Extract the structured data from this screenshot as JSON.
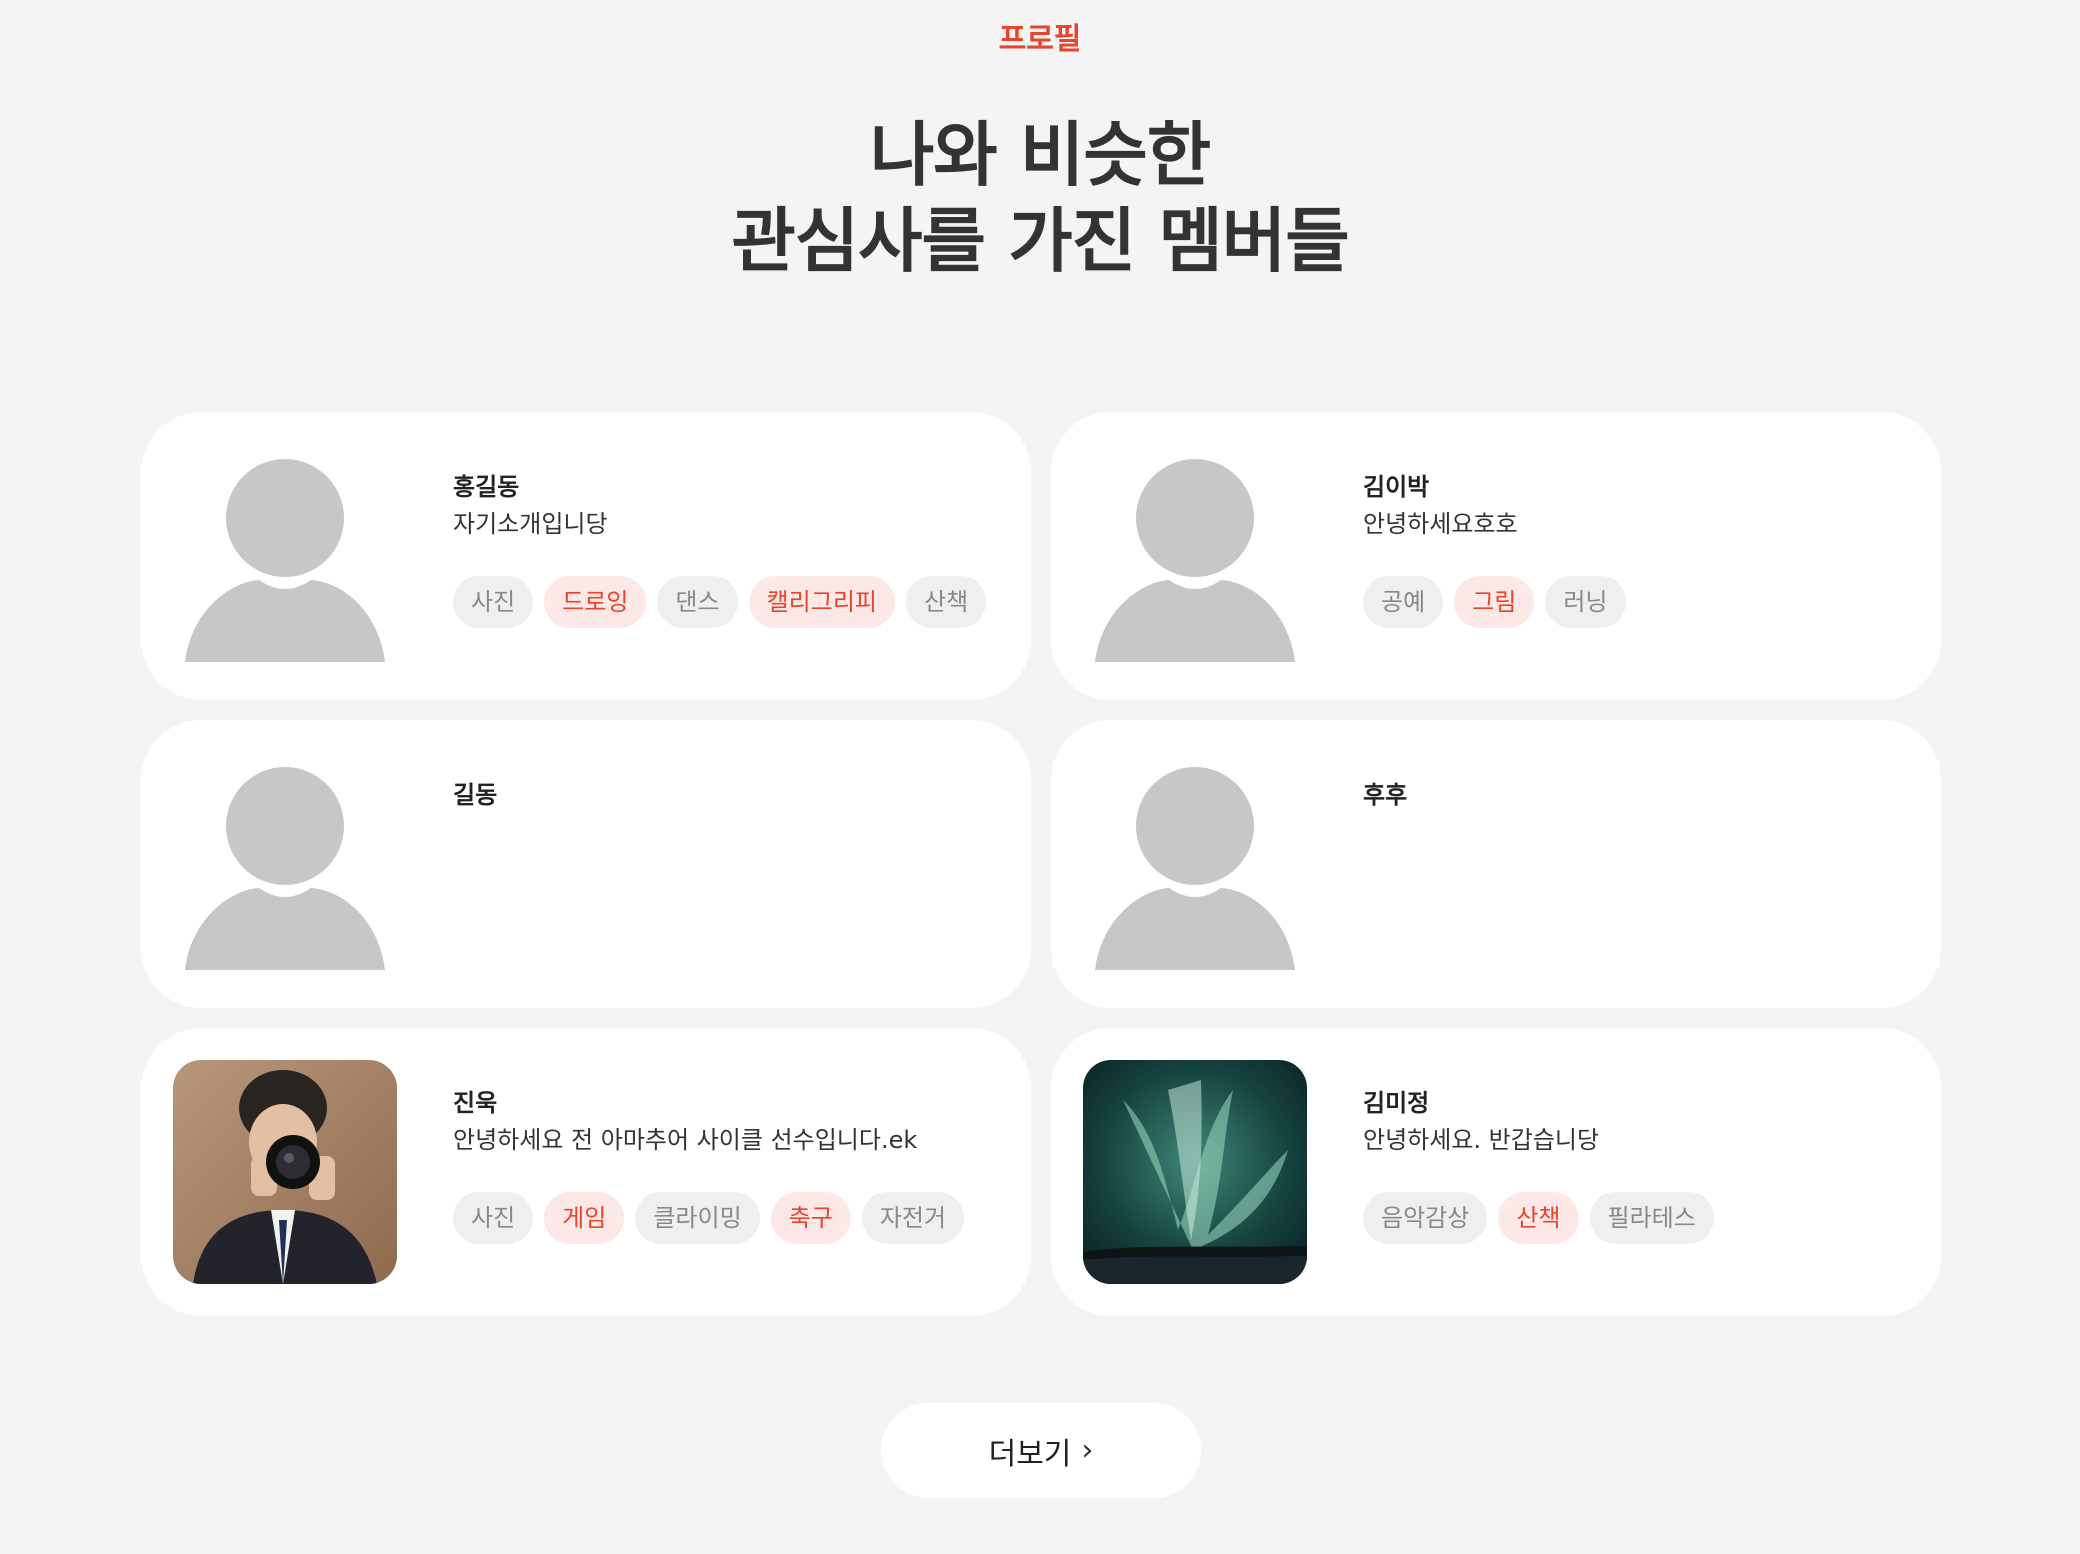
{
  "eyebrow": "프로필",
  "heading": {
    "line1": "나와 비슷한",
    "line2": "관심사를 가진 멤버들"
  },
  "members": [
    {
      "name": "홍길동",
      "intro": "자기소개입니당",
      "photo": "default-avatar-icon",
      "tags": [
        {
          "label": "사진",
          "hl": false
        },
        {
          "label": "드로잉",
          "hl": true
        },
        {
          "label": "댄스",
          "hl": false
        },
        {
          "label": "캘리그리피",
          "hl": true
        },
        {
          "label": "산책",
          "hl": false
        }
      ]
    },
    {
      "name": "김이박",
      "intro": "안녕하세요호호",
      "photo": "default-avatar-icon",
      "tags": [
        {
          "label": "공예",
          "hl": false
        },
        {
          "label": "그림",
          "hl": true
        },
        {
          "label": "러닝",
          "hl": false
        }
      ]
    },
    {
      "name": "길동",
      "intro": "",
      "photo": "default-avatar-icon",
      "tags": []
    },
    {
      "name": "후후",
      "intro": "",
      "photo": "default-avatar-icon",
      "tags": []
    },
    {
      "name": "진욱",
      "intro": "안녕하세요 전 아마추어 사이클 선수입니다.ek",
      "photo": "camera-person-photo",
      "tags": [
        {
          "label": "사진",
          "hl": false
        },
        {
          "label": "게임",
          "hl": true
        },
        {
          "label": "클라이밍",
          "hl": false
        },
        {
          "label": "축구",
          "hl": true
        },
        {
          "label": "자전거",
          "hl": false
        }
      ]
    },
    {
      "name": "김미정",
      "intro": "안녕하세요. 반갑습니당",
      "photo": "aurora-photo",
      "tags": [
        {
          "label": "음악감상",
          "hl": false
        },
        {
          "label": "산책",
          "hl": true
        },
        {
          "label": "필라테스",
          "hl": false
        }
      ]
    }
  ],
  "more_button": {
    "label": "더보기",
    "icon": "chevron-right-icon"
  },
  "colors": {
    "accent": "#e8452f",
    "tag_hl_bg": "#fde8e8",
    "tag_bg": "#efefef",
    "page_bg": "#f4f4f4"
  }
}
